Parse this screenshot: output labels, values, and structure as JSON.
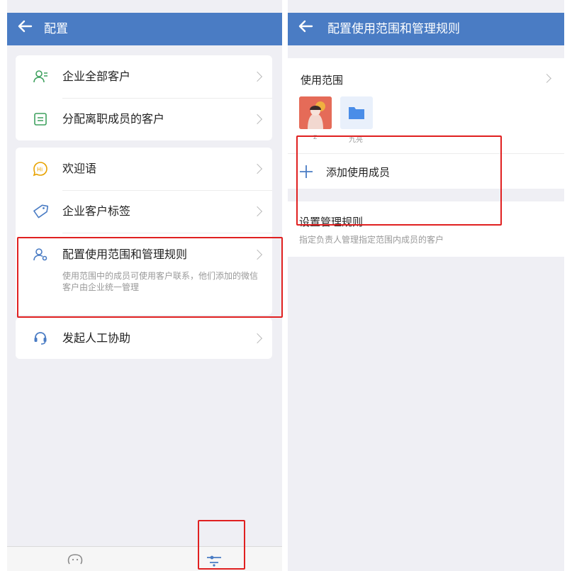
{
  "left": {
    "header": {
      "back_icon": "arrow-left-icon",
      "title": "配置"
    },
    "group1": [
      {
        "label": "企业全部客户",
        "icon": "customers-icon"
      },
      {
        "label": "分配离职成员的客户",
        "icon": "assign-list-icon"
      }
    ],
    "group2": [
      {
        "label": "欢迎语",
        "icon": "hi-chat-icon"
      },
      {
        "label": "企业客户标签",
        "icon": "tag-icon"
      },
      {
        "label": "配置使用范围和管理规则",
        "icon": "member-settings-icon",
        "desc": "使用范围中的成员可使用客户联系，他们添加的微信客户由企业统一管理"
      }
    ],
    "group3": [
      {
        "label": "发起人工协助",
        "icon": "headset-icon"
      }
    ]
  },
  "right": {
    "header": {
      "back_icon": "arrow-left-icon",
      "title": "配置使用范围和管理规则"
    },
    "scope": {
      "title": "使用范围",
      "members": [
        {
          "name": "z",
          "type": "avatar"
        },
        {
          "name": "九亮",
          "type": "folder"
        }
      ]
    },
    "add_member": "添加使用成员",
    "rules": {
      "title": "设置管理规则",
      "desc": "指定负责人管理指定范围内成员的客户"
    }
  },
  "colors": {
    "header": "#4a7cc4",
    "accent_green": "#3fa15f",
    "accent_blue": "#4a7cc4",
    "highlight": "#e02020"
  }
}
